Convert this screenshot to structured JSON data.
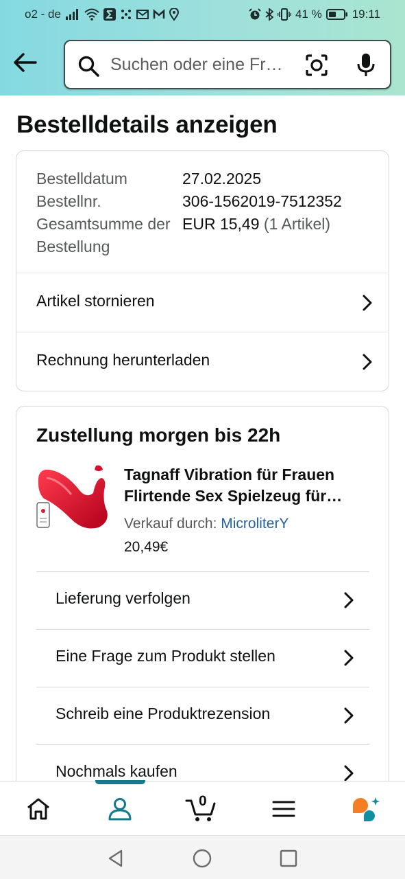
{
  "status_bar": {
    "carrier": "o2 - de",
    "battery": "41 %",
    "time": "19:11"
  },
  "search": {
    "placeholder": "Suchen oder eine Frage stellen"
  },
  "page": {
    "title": "Bestelldetails anzeigen"
  },
  "order": {
    "date_label": "Bestelldatum",
    "date": "27.02.2025",
    "number_label": "Bestellnr.",
    "number": "306-1562019-7512352",
    "total_label": "Gesamtsumme der Bestellung",
    "total": "EUR 15,49",
    "items_count": "(1 Artikel)",
    "actions": [
      {
        "label": "Artikel stornieren"
      },
      {
        "label": "Rechnung herunterladen"
      }
    ]
  },
  "shipment": {
    "delivery_title": "Zustellung morgen bis 22h",
    "product_title": "Tagnaff Vibration für Frauen Flirtende Sex Spielzeug für Frauen",
    "sold_by_label": "Verkauf durch:",
    "seller": "MicroliterY",
    "price": "20,49€",
    "actions": [
      {
        "label": "Lieferung verfolgen"
      },
      {
        "label": "Eine Frage zum Produkt stellen"
      },
      {
        "label": "Schreib eine Produktrezension"
      },
      {
        "label": "Nochmals kaufen"
      }
    ]
  },
  "bottom_nav": {
    "items": [
      "home-icon",
      "account-icon",
      "cart-icon",
      "menu-icon",
      "rufus-icon"
    ],
    "active": "account-icon",
    "cart_count": "0"
  },
  "colors": {
    "accent": "#117a8b",
    "link": "#2162a1",
    "rufus_orange": "#f57d24",
    "rufus_teal": "#0f8fa0"
  }
}
